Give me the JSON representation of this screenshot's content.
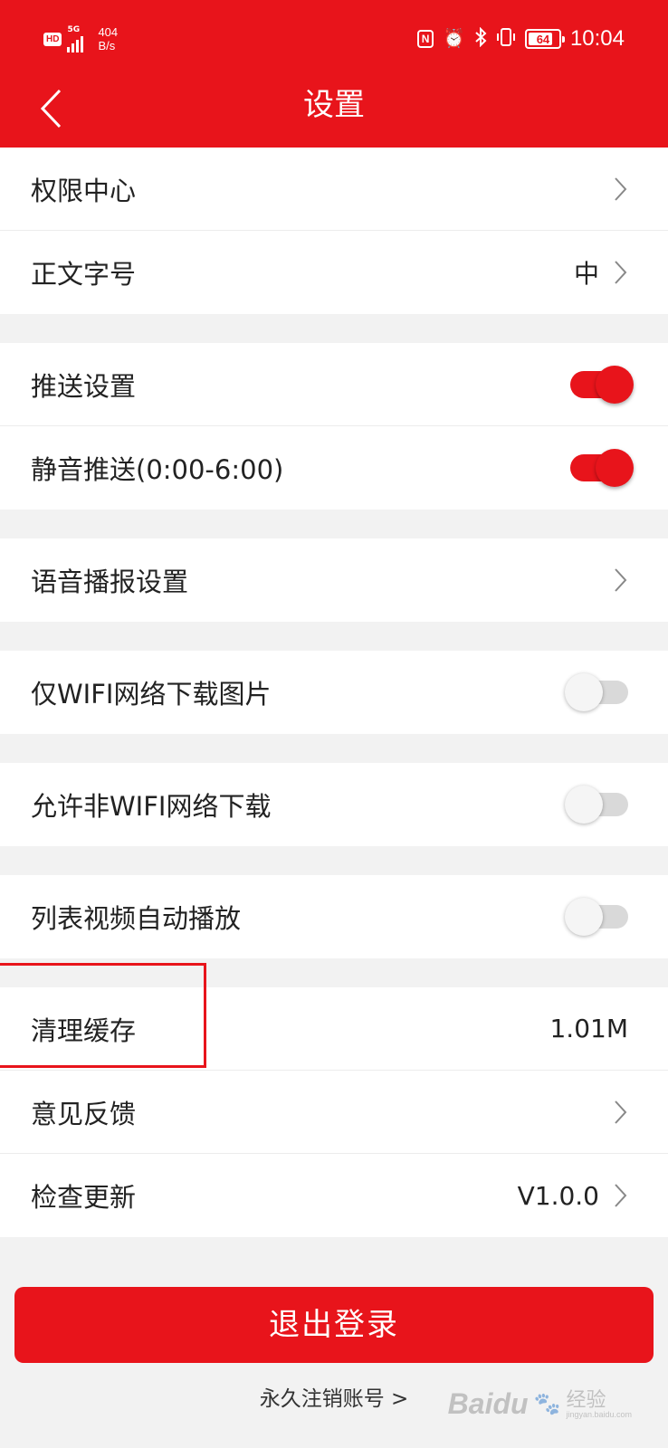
{
  "status_bar": {
    "hd_badge": "HD",
    "network_type": "5G",
    "net_speed_value": "404",
    "net_speed_unit": "B/s",
    "nfc_label": "N",
    "battery_level": "64",
    "time": "10:04"
  },
  "header": {
    "title": "设置"
  },
  "settings": {
    "permission_center": {
      "label": "权限中心"
    },
    "font_size": {
      "label": "正文字号",
      "value": "中"
    },
    "push_settings": {
      "label": "推送设置",
      "enabled": true
    },
    "silent_push": {
      "label": "静音推送(0:00-6:00)",
      "enabled": true
    },
    "voice_broadcast": {
      "label": "语音播报设置"
    },
    "wifi_only_images": {
      "label": "仅WIFI网络下载图片",
      "enabled": false
    },
    "allow_non_wifi": {
      "label": "允许非WIFI网络下载",
      "enabled": false
    },
    "autoplay_video": {
      "label": "列表视频自动播放",
      "enabled": false
    },
    "clear_cache": {
      "label": "清理缓存",
      "value": "1.01M"
    },
    "feedback": {
      "label": "意见反馈"
    },
    "check_update": {
      "label": "检查更新",
      "value": "V1.0.0"
    }
  },
  "actions": {
    "logout_label": "退出登录",
    "deactivate_label": "永久注销账号 >"
  },
  "watermark": {
    "logo": "Baidu",
    "text": "经验",
    "url": "jingyan.baidu.com"
  },
  "colors": {
    "brand_red": "#e8141b",
    "background": "#f2f2f2",
    "toggle_off": "#d9d9d9"
  }
}
